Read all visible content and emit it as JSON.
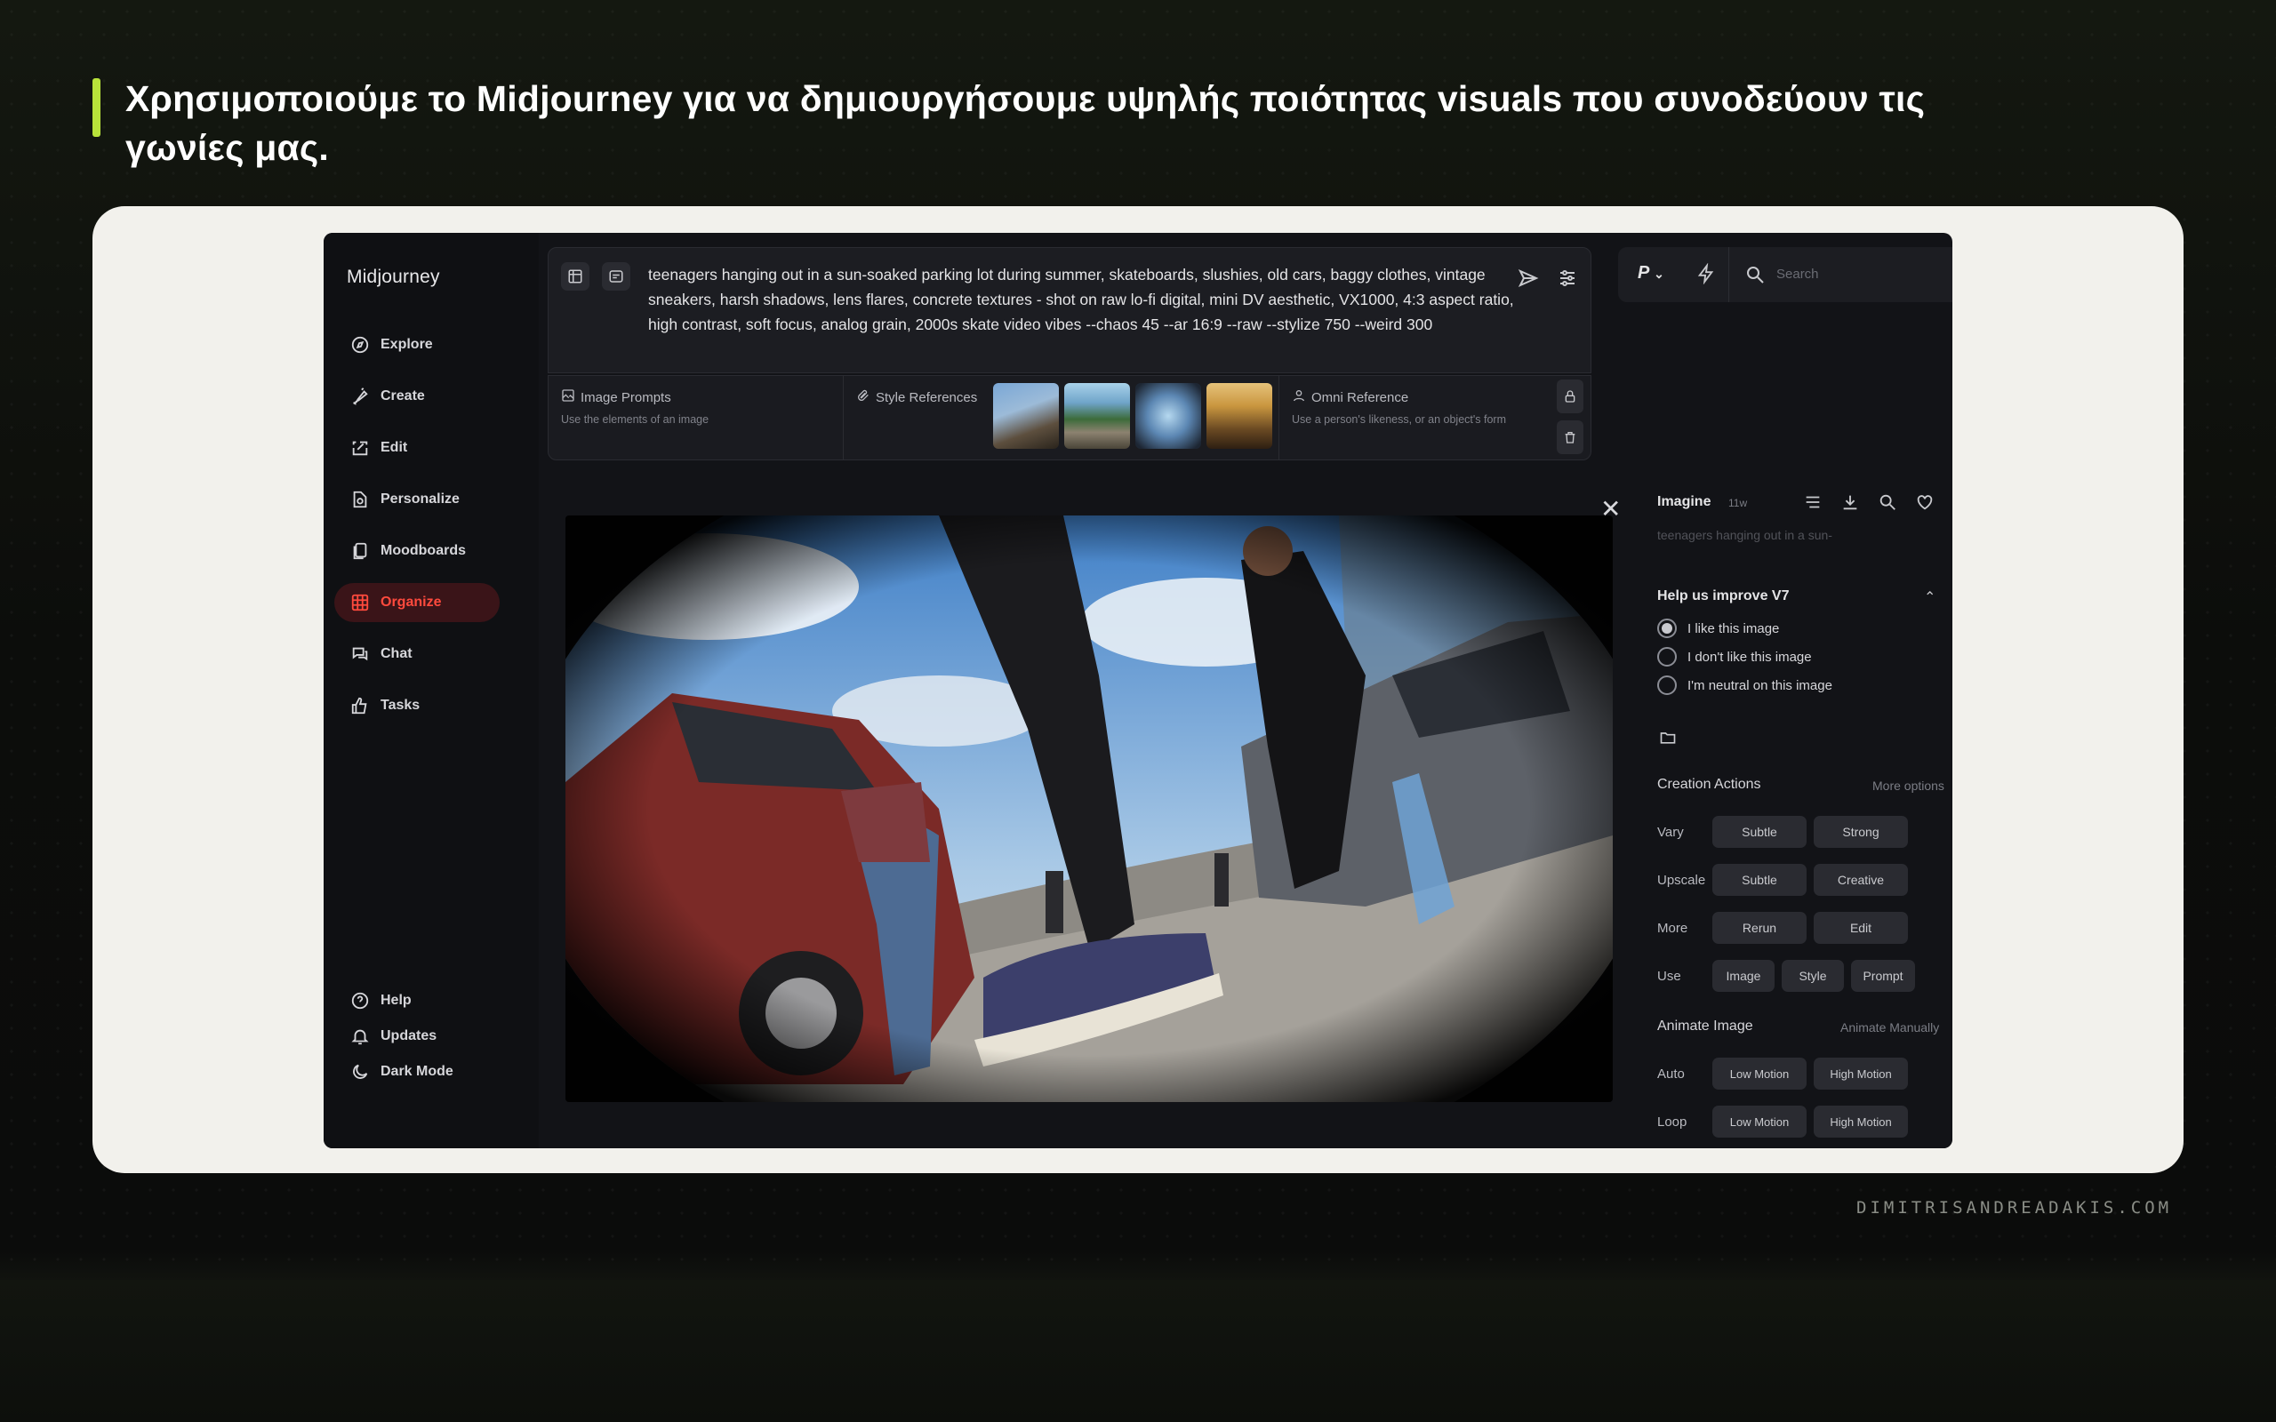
{
  "headline": "Χρησιμοποιούμε το Midjourney για να δημιουργήσουμε υψηλής ποιότητας visuals που συνοδεύουν τις γωνίες μας.",
  "footer_url": "DIMITRISANDREADAKIS.COM",
  "colors": {
    "accent": "#b8e23a",
    "active_nav": "#ff4a3d",
    "card_bg": "#f2f1ec",
    "app_bg": "#121317"
  },
  "sidebar": {
    "brand": "Midjourney",
    "items": [
      {
        "label": "Explore",
        "icon": "compass-icon"
      },
      {
        "label": "Create",
        "icon": "brush-icon"
      },
      {
        "label": "Edit",
        "icon": "edit-icon"
      },
      {
        "label": "Personalize",
        "icon": "personalize-icon"
      },
      {
        "label": "Moodboards",
        "icon": "moodboards-icon"
      },
      {
        "label": "Organize",
        "icon": "grid-icon",
        "active": true
      },
      {
        "label": "Chat",
        "icon": "chat-icon"
      },
      {
        "label": "Tasks",
        "icon": "thumbs-up-icon"
      }
    ],
    "bottom": [
      {
        "label": "Help",
        "icon": "help-icon"
      },
      {
        "label": "Updates",
        "icon": "bell-icon"
      },
      {
        "label": "Dark Mode",
        "icon": "moon-icon"
      }
    ]
  },
  "prompt": {
    "text": "teenagers hanging out in a sun-soaked parking lot during summer, skateboards, slushies, old cars, baggy clothes, vintage sneakers, harsh shadows, lens flares, concrete textures - shot on raw lo-fi digital, mini DV aesthetic, VX1000, 4:3 aspect ratio, high contrast, soft focus, analog grain, 2000s skate video vibes --chaos 45 --ar 16:9 --raw --stylize 750 --weird 300"
  },
  "refs": {
    "image_prompts": {
      "title": "Image Prompts",
      "subtitle": "Use the elements of an image"
    },
    "style_references": {
      "title": "Style References"
    },
    "omni_reference": {
      "title": "Omni Reference",
      "subtitle": "Use a person's likeness, or an object's form"
    }
  },
  "topbar": {
    "profile": "P",
    "search_placeholder": "Search"
  },
  "panel": {
    "imagine_label": "Imagine",
    "age": "11w",
    "prompt_preview": "teenagers hanging out in a sun-",
    "feedback_title": "Help us improve V7",
    "feedback_options": [
      {
        "label": "I like this image",
        "selected": true
      },
      {
        "label": "I don't like this image",
        "selected": false
      },
      {
        "label": "I'm neutral on this image",
        "selected": false
      }
    ],
    "creation_title": "Creation Actions",
    "more_options": "More options",
    "vary": {
      "label": "Vary",
      "buttons": [
        "Subtle",
        "Strong"
      ]
    },
    "upscale": {
      "label": "Upscale",
      "buttons": [
        "Subtle",
        "Creative"
      ]
    },
    "more": {
      "label": "More",
      "buttons": [
        "Rerun",
        "Edit"
      ]
    },
    "use": {
      "label": "Use",
      "buttons": [
        "Image",
        "Style",
        "Prompt"
      ]
    },
    "animate_title": "Animate Image",
    "animate_manually": "Animate Manually",
    "auto": {
      "label": "Auto",
      "buttons": [
        "Low Motion",
        "High Motion"
      ]
    },
    "loop": {
      "label": "Loop",
      "buttons": [
        "Low Motion",
        "High Motion"
      ]
    }
  }
}
